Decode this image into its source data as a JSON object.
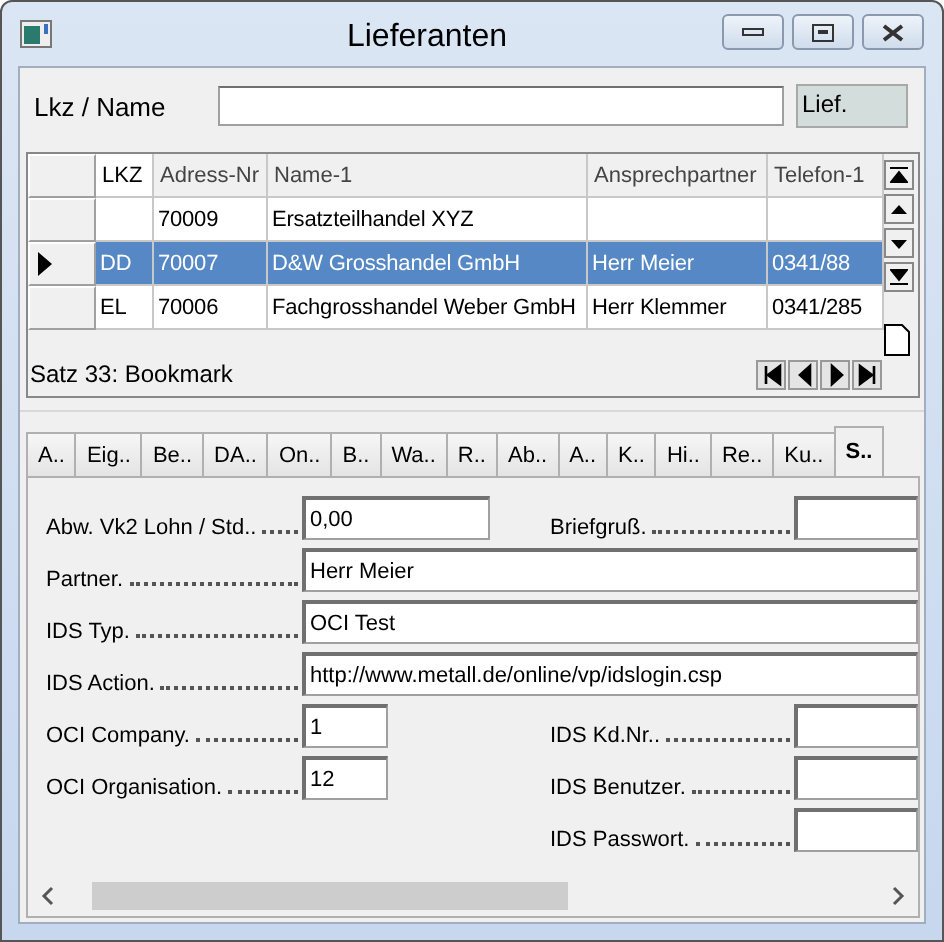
{
  "window": {
    "title": "Lieferanten"
  },
  "search": {
    "label": "Lkz / Name",
    "badge": "Lief."
  },
  "table": {
    "columns": [
      "LKZ",
      "Adress-Nr",
      "Name-1",
      "Ansprechpartner",
      "Telefon-1"
    ],
    "rows": [
      {
        "selected": false,
        "cells": [
          "",
          "70009",
          "Ersatzteilhandel XYZ",
          "",
          ""
        ]
      },
      {
        "selected": true,
        "cells": [
          "DD",
          "70007",
          "D&W Grosshandel GmbH",
          "Herr Meier",
          "0341/88"
        ]
      },
      {
        "selected": false,
        "cells": [
          "EL",
          "70006",
          "Fachgrosshandel Weber GmbH",
          "Herr Klemmer",
          "0341/285"
        ]
      }
    ],
    "status": "Satz 33: Bookmark"
  },
  "tabs": [
    {
      "label": "A..",
      "selected": false
    },
    {
      "label": "Eig..",
      "selected": false
    },
    {
      "label": "Be..",
      "selected": false
    },
    {
      "label": "DA..",
      "selected": false
    },
    {
      "label": "On..",
      "selected": false
    },
    {
      "label": "B..",
      "selected": false
    },
    {
      "label": "Wa..",
      "selected": false
    },
    {
      "label": "R..",
      "selected": false
    },
    {
      "label": "Ab..",
      "selected": false
    },
    {
      "label": "A..",
      "selected": false
    },
    {
      "label": "K..",
      "selected": false
    },
    {
      "label": "Hi..",
      "selected": false
    },
    {
      "label": "Re..",
      "selected": false
    },
    {
      "label": "Ku..",
      "selected": false
    },
    {
      "label": "S..",
      "selected": true
    }
  ],
  "form": [
    {
      "left": {
        "label": "Abw. Vk2 Lohn / Std..",
        "value": "0,00",
        "kind": "medium"
      },
      "right": {
        "label": "Briefgruß."
      }
    },
    {
      "left": {
        "label": "Partner.",
        "value": "Herr Meier",
        "kind": "wide"
      }
    },
    {
      "left": {
        "label": "IDS Typ.",
        "value": "OCI Test",
        "kind": "wide"
      }
    },
    {
      "left": {
        "label": "IDS Action.",
        "value": "http://www.metall.de/online/vp/idslogin.csp",
        "kind": "wide"
      }
    },
    {
      "left": {
        "label": "OCI Company.",
        "value": "1",
        "kind": "short"
      },
      "right": {
        "label": "IDS Kd.Nr.."
      }
    },
    {
      "left": {
        "label": "OCI Organisation.",
        "value": "12",
        "kind": "short"
      },
      "right": {
        "label": "IDS Benutzer."
      }
    },
    {
      "right": {
        "label": "IDS Passwort."
      }
    }
  ]
}
